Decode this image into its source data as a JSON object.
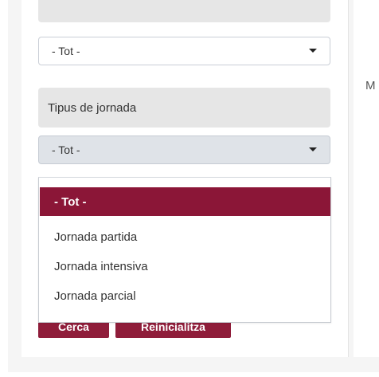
{
  "filters": {
    "top_select_value": "- Tot -",
    "jornada_label": "Tipus de jornada",
    "jornada_select_value": "- Tot -"
  },
  "dropdown": {
    "options": [
      "- Tot -",
      "Jornada partida",
      "Jornada intensiva",
      "Jornada parcial"
    ]
  },
  "actions": {
    "search_label": "Cerca",
    "reset_label": "Reinicialitza"
  },
  "side": {
    "truncated_text": "M"
  },
  "colors": {
    "accent": "#8b1637",
    "label_background": "#e6e6e6",
    "select_background": "#dfe3e8",
    "panel_background": "#f5f5f5"
  },
  "icons": {
    "select_icon": "chevron-down-icon",
    "dropdown_icon": "chevron-down-icon"
  }
}
